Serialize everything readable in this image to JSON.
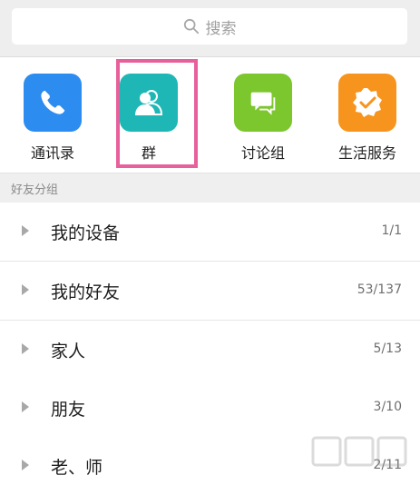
{
  "search": {
    "placeholder": "搜索",
    "icon": "search-icon"
  },
  "quick_actions": [
    {
      "label": "通讯录",
      "icon": "phone-icon",
      "color": "#2d8cf0"
    },
    {
      "label": "群",
      "icon": "group-icon",
      "color": "#1fb7b5",
      "highlighted": true
    },
    {
      "label": "讨论组",
      "icon": "chat-bubbles-icon",
      "color": "#7cc62e"
    },
    {
      "label": "生活服务",
      "icon": "badge-check-icon",
      "color": "#f7941d"
    }
  ],
  "section": {
    "title": "好友分组"
  },
  "groups": [
    {
      "name": "我的设备",
      "count": "1/1"
    },
    {
      "name": "我的好友",
      "count": "53/137"
    },
    {
      "name": "家人",
      "count": "5/13"
    },
    {
      "name": "朋友",
      "count": "3/10"
    },
    {
      "name": "老、师",
      "count": "2/11"
    }
  ],
  "colors": {
    "highlight": "#e8609b",
    "section_bg": "#efefef"
  }
}
